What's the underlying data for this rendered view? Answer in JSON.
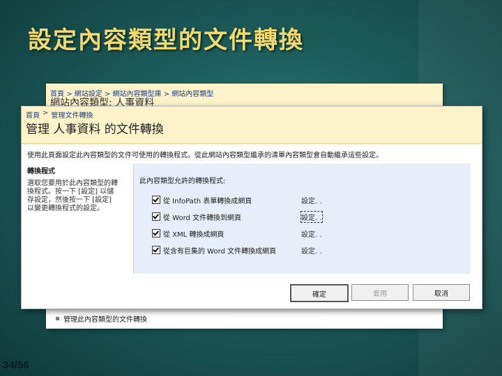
{
  "slide": {
    "title": "設定內容類型的文件轉換",
    "page_number": "34/56"
  },
  "back_window": {
    "breadcrumbs": [
      "首頁",
      "網站設定",
      "網站內容類型庫",
      "網站內容類型"
    ],
    "title": "網站內容類型: 人事資料",
    "link": "管理此內容類型的文件轉換"
  },
  "front_window": {
    "breadcrumbs": [
      "首頁",
      "管理文件轉換"
    ],
    "heading": "管理 人事資料 的文件轉換",
    "description": "使用此頁面設定此內容類型的文件可使用的轉換程式。從此網站內容類型繼承的清單內容類型會自動繼承這些設定。",
    "section": {
      "title": "轉換程式",
      "description": "選取您要用於此內容類型的轉換程式。按一下 [設定] 以儲存設定，然後按一下 [設定] 以變更轉換程式的設定。",
      "allowed_label": "此內容類型允許的轉換程式:",
      "converters": [
        {
          "label": "從 InfoPath 表單轉換成網頁",
          "checked": true,
          "settings": "設定. ."
        },
        {
          "label": "從 Word 文件轉換到網頁",
          "checked": true,
          "settings": "設定. ."
        },
        {
          "label": "從 XML 轉換成網頁",
          "checked": true,
          "settings": "設定. ."
        },
        {
          "label": "從含有巨集的 Word 文件轉換成網頁",
          "checked": true,
          "settings": "設定. ."
        }
      ]
    },
    "buttons": {
      "ok": "確定",
      "apply": "套用",
      "cancel": "取消"
    }
  }
}
